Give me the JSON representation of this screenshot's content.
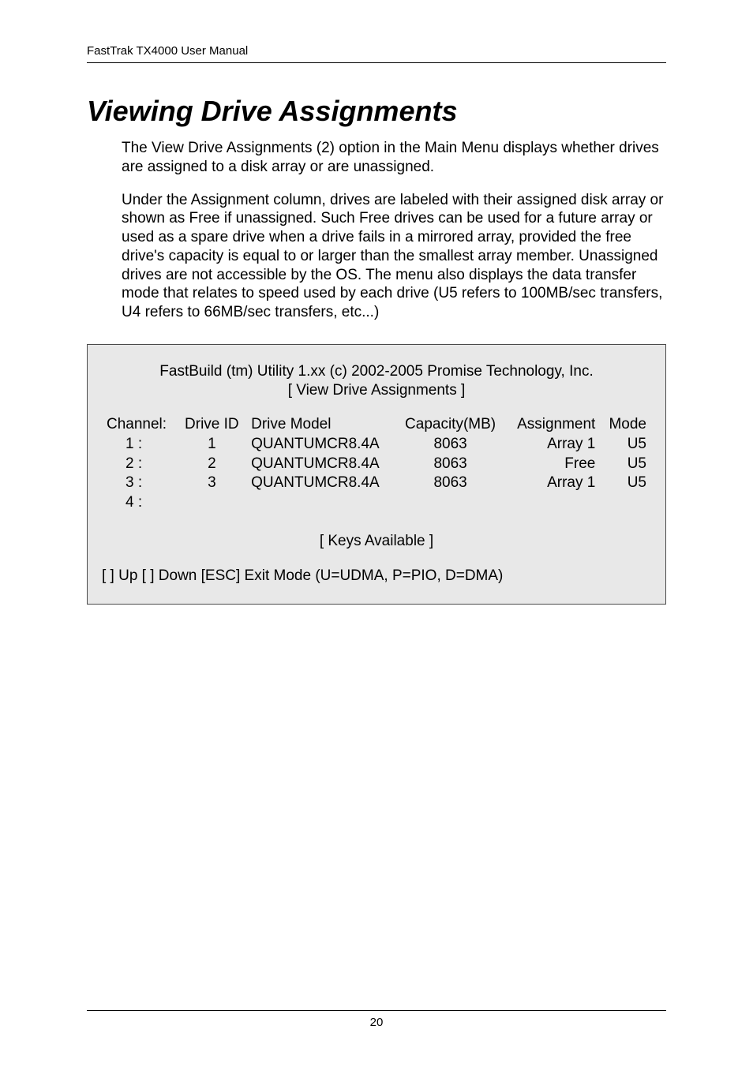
{
  "header": {
    "running": "FastTrak TX4000 User Manual"
  },
  "section": {
    "title": "Viewing Drive Assignments",
    "para1": "The View Drive Assignments (2) option in the Main Menu displays whether drives are assigned to a disk array or are unassigned.",
    "para2": "Under the Assignment column, drives are labeled with their assigned disk array or shown as Free if unassigned. Such Free drives can be used for a future array or used as a spare drive when a drive fails in a mirrored array, provided the free drive's capacity is equal to or larger than the smallest array member. Unassigned drives are not accessible by the OS. The menu also displays the data transfer mode that relates to speed used by each drive (U5 refers to 100MB/sec transfers, U4 refers to 66MB/sec transfers, etc...)"
  },
  "panel": {
    "title_line": "FastBuild (tm) Utility 1.xx (c) 2002-2005 Promise Technology, Inc.",
    "subtitle_line": "[ View Drive Assignments ]",
    "columns": {
      "channel": "Channel:",
      "drive_id": "Drive ID",
      "drive_model": "Drive Model",
      "capacity": "Capacity(MB)",
      "assignment": "Assignment",
      "mode": "Mode"
    },
    "rows": [
      {
        "channel": "1 :",
        "drive_id": "1",
        "model": "QUANTUMCR8.4A",
        "capacity": "8063",
        "assignment": "Array 1",
        "mode": "U5"
      },
      {
        "channel": "2 :",
        "drive_id": "2",
        "model": "QUANTUMCR8.4A",
        "capacity": "8063",
        "assignment": "Free",
        "mode": "U5"
      },
      {
        "channel": "3 :",
        "drive_id": "3",
        "model": "QUANTUMCR8.4A",
        "capacity": "8063",
        "assignment": "Array 1",
        "mode": "U5"
      },
      {
        "channel": "4 :",
        "drive_id": "",
        "model": "",
        "capacity": "",
        "assignment": "",
        "mode": ""
      }
    ],
    "keys_label": "[ Keys Available ]",
    "footer_keys": "[  ] Up [  ] Down  [ESC] Exit   Mode (U=UDMA, P=PIO, D=DMA)"
  },
  "footer": {
    "page_num": "20"
  }
}
